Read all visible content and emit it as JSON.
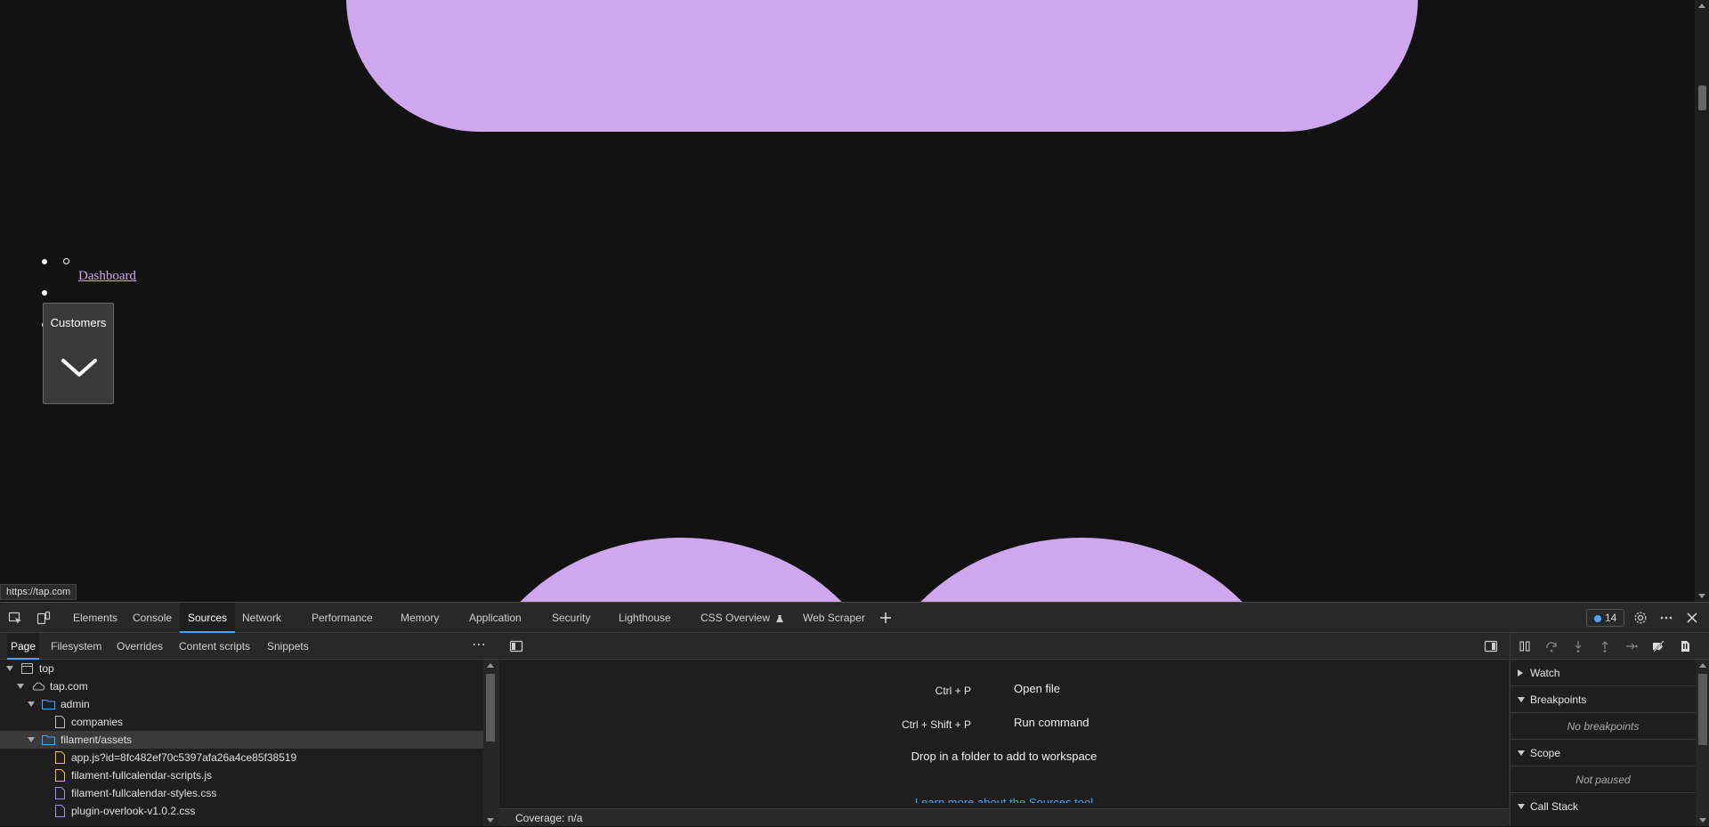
{
  "page": {
    "nav_link": "Dashboard",
    "customers_label": "Customers",
    "status_url": "https://tap.com"
  },
  "colors": {
    "blob": "#cfa7ef",
    "page_bg": "#131213",
    "accent": "#4da3ff"
  },
  "devtools": {
    "tabs": [
      "Elements",
      "Console",
      "Sources",
      "Network",
      "Performance",
      "Memory",
      "Application",
      "Security",
      "Lighthouse",
      "CSS Overview",
      "Web Scraper"
    ],
    "active_tab": "Sources",
    "issues_count": "14",
    "navigator": {
      "subtabs": [
        "Page",
        "Filesystem",
        "Overrides",
        "Content scripts",
        "Snippets"
      ],
      "active_subtab": "Page",
      "tree": [
        {
          "label": "top",
          "type": "frame",
          "depth": 0,
          "expanded": true
        },
        {
          "label": "tap.com",
          "type": "cloud",
          "depth": 1,
          "expanded": true
        },
        {
          "label": "admin",
          "type": "folder",
          "depth": 2,
          "expanded": true
        },
        {
          "label": "companies",
          "type": "file",
          "depth": 3
        },
        {
          "label": "filament/assets",
          "type": "folder",
          "depth": 2,
          "expanded": true,
          "selected": true
        },
        {
          "label": "app.js?id=8fc482ef70c5397afa26a4ce85f38519",
          "type": "js",
          "depth": 3
        },
        {
          "label": "filament-fullcalendar-scripts.js",
          "type": "js",
          "depth": 3
        },
        {
          "label": "filament-fullcalendar-styles.css",
          "type": "css",
          "depth": 3
        },
        {
          "label": "plugin-overlook-v1.0.2.css",
          "type": "css",
          "depth": 3
        }
      ]
    },
    "editor": {
      "shortcuts": [
        {
          "keys": "Ctrl + P",
          "action": "Open file"
        },
        {
          "keys": "Ctrl + Shift + P",
          "action": "Run command"
        }
      ],
      "drop_text": "Drop in a folder to add to workspace",
      "learn_more": "Learn more about the Sources tool",
      "coverage": "Coverage: n/a"
    },
    "debugger": {
      "watch": "Watch",
      "breakpoints": "Breakpoints",
      "no_breakpoints": "No breakpoints",
      "scope": "Scope",
      "not_paused": "Not paused",
      "call_stack": "Call Stack"
    }
  }
}
